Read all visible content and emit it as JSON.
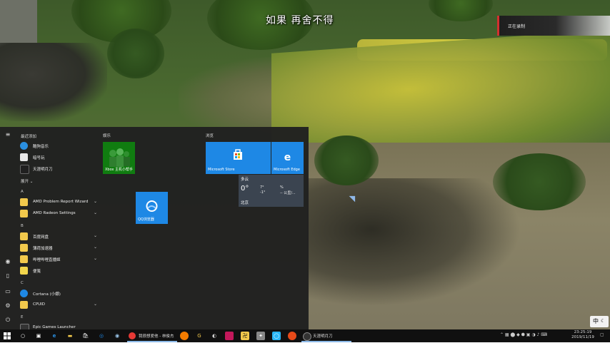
{
  "subtitle": "如果 再舍不得",
  "recording": {
    "label": "正在录制"
  },
  "start_menu": {
    "recent_header": "最近添加",
    "recent": [
      {
        "label": "酷狗音乐",
        "color": "#2a8fe0"
      },
      {
        "label": "暗号玩",
        "color": "#e8e8e8"
      },
      {
        "label": "天涯明月刀",
        "color": "#202020"
      }
    ],
    "expand_label": "展开",
    "letters": [
      "A",
      "B",
      "C",
      "E"
    ],
    "apps": [
      {
        "label": "AMD Problem Report Wizard",
        "chevron": "⌄",
        "color": "#f2c94c"
      },
      {
        "label": "AMD Radeon Settings",
        "chevron": "⌄",
        "color": "#f2c94c"
      },
      {
        "label": "百度网盘",
        "chevron": "⌄",
        "color": "#f2c94c"
      },
      {
        "label": "薄荷加速器",
        "chevron": "⌄",
        "color": "#f2c94c"
      },
      {
        "label": "哔哩哔哩直播姬",
        "chevron": "⌄",
        "color": "#f2c94c"
      },
      {
        "label": "便笺",
        "chevron": "",
        "color": "#f2d64c"
      },
      {
        "label": "Cortana (小娜)",
        "chevron": "",
        "color": "#1e88e5"
      },
      {
        "label": "CPUID",
        "chevron": "⌄",
        "color": "#f2c94c"
      },
      {
        "label": "Epic Games Launcher",
        "chevron": "",
        "color": "#333333"
      }
    ],
    "groups": {
      "entertainment": "娱乐",
      "browse": "浏览"
    },
    "tiles": {
      "xbox": {
        "label": "Xbox 主机小帮手",
        "color": "#107c10"
      },
      "qq_browser": {
        "label": "QQ浏览器",
        "color": "#1e88e5"
      },
      "store": {
        "label": "Microsoft Store",
        "color": "#1e88e5"
      },
      "edge": {
        "label": "Microsoft Edge",
        "color": "#1e88e5"
      }
    },
    "weather": {
      "condition": "多云",
      "temp": "0°",
      "high": "7°",
      "low": "-1°",
      "humidity": "%",
      "wind": "-- 公里/...",
      "city": "北京"
    }
  },
  "taskbar": {
    "tasks": [
      {
        "label": "我很想爱他 - 林俊杰",
        "color": "#e53935"
      },
      {
        "label": "天涯明月刀",
        "color": "#333333"
      }
    ],
    "time": "23:25:19",
    "date": "2019/11/19",
    "ime": "中"
  }
}
